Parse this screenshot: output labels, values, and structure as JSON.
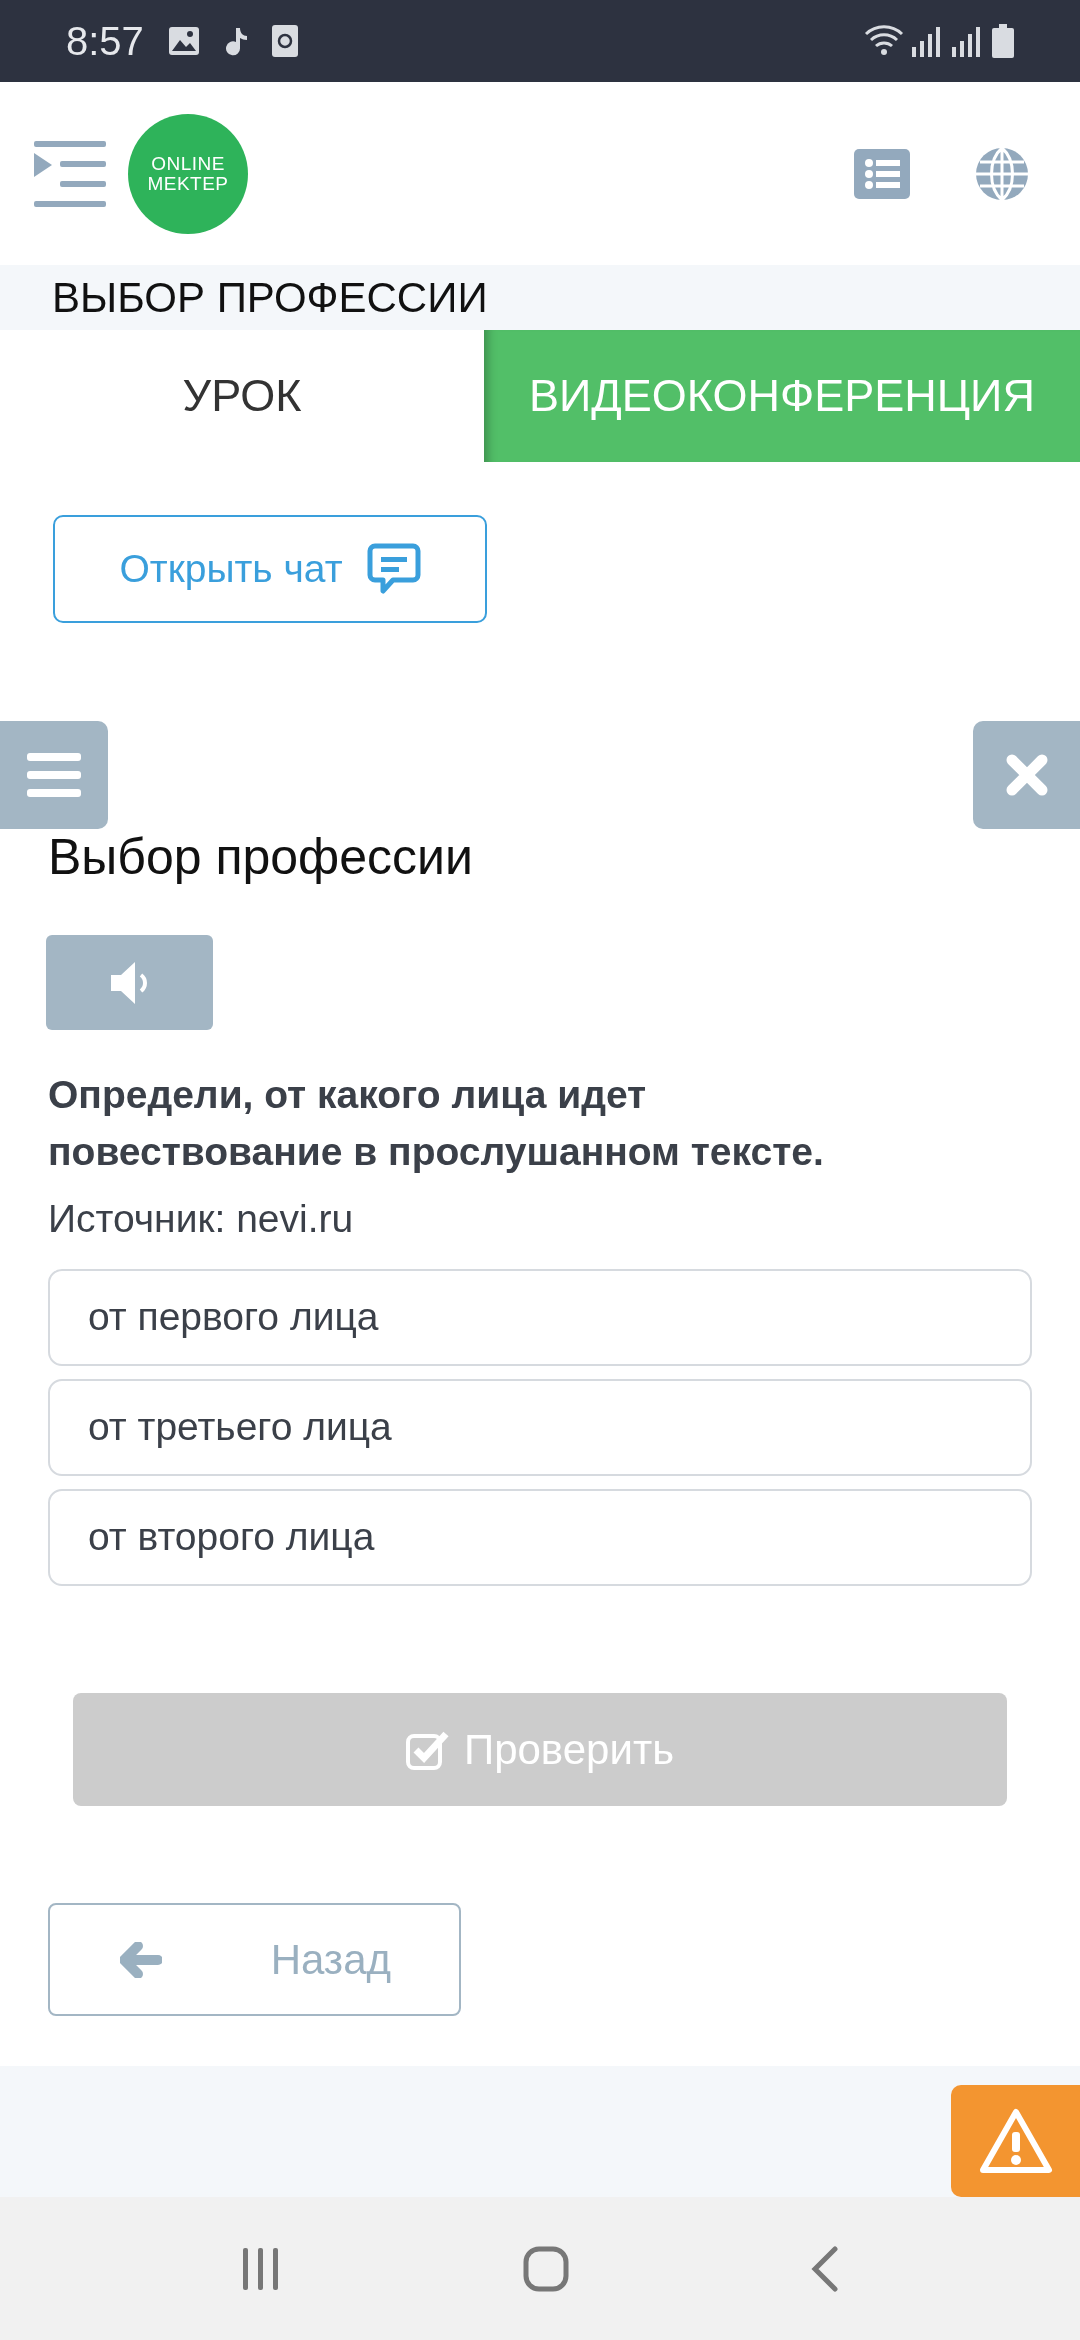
{
  "status_bar": {
    "time": "8:57"
  },
  "header": {
    "logo_lines": [
      "ONLINE",
      "MEKTEP"
    ]
  },
  "lesson_title": "ВЫБОР ПРОФЕССИИ",
  "tabs": [
    {
      "label": "УРОК",
      "selected": true
    },
    {
      "label": "ВИДЕОКОНФЕРЕНЦИЯ",
      "selected": false
    }
  ],
  "open_chat_button": "Открыть чат",
  "task": {
    "title": "Выбор профессии",
    "question": "Определи, от какого лица идет повествование в прослушанном тексте.",
    "source": "Источник: nevi.ru",
    "options": [
      {
        "label": "от первого лица",
        "selected": false
      },
      {
        "label": "от третьего лица",
        "selected": false
      },
      {
        "label": "от второго лица",
        "selected": false
      }
    ],
    "check_button": {
      "label": "Проверить",
      "disabled": true
    }
  },
  "back_button": "Назад"
}
